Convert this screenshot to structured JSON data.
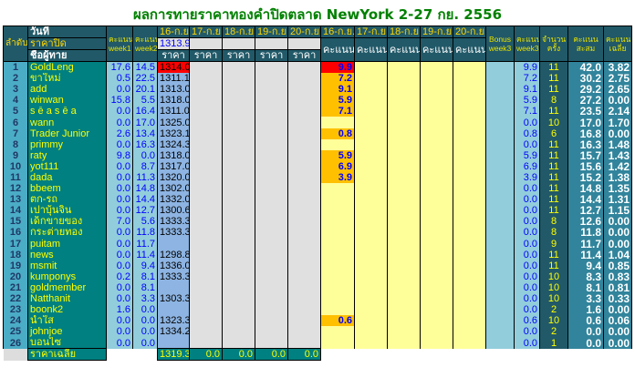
{
  "title": "ผลการทายราคาทองคำปิดตลาด NewYork 2-27 กย. 2556",
  "header": {
    "rank": "ลำดับ",
    "date_label": "วันที่",
    "close_label": "ราคาปิด",
    "name_label": "ชื่อผู้ทาย",
    "week1": "คะแนน week1",
    "week2": "คะแนน week2",
    "dates": [
      "16-ก.ย.",
      "17-ก.ย.",
      "18-ก.ย.",
      "19-ก.ย.",
      "20-ก.ย."
    ],
    "close_prices": [
      "1313.9",
      "",
      "",
      "",
      ""
    ],
    "price_label": "ราคา",
    "score_label": "คะแนน",
    "bonus": "Bonus week3",
    "week3": "คะแนน week3",
    "count": "จำนวนครั้ง",
    "total": "คะแนนสะสม",
    "avg": "คะแนนเฉลี่ย"
  },
  "colors": {
    "header": "#215968",
    "name_col": "#008080",
    "highlight": "#ffc000",
    "best": "#ff0000",
    "title": "#008000"
  },
  "rows": [
    {
      "rank": "1",
      "name": "GoldLeng",
      "w1": "17.6",
      "w2": "14.5",
      "price": "1314.0",
      "score": "9.9",
      "w3": "9.9",
      "count": "11",
      "total": "42.0",
      "avg": "3.82",
      "best": true
    },
    {
      "rank": "2",
      "name": "ขาใหม่",
      "w1": "0.5",
      "w2": "22.5",
      "price": "1311.1",
      "score": "7.2",
      "w3": "7.2",
      "count": "11",
      "total": "30.2",
      "avg": "2.75"
    },
    {
      "rank": "3",
      "name": "add",
      "w1": "0.0",
      "w2": "20.1",
      "price": "1313.0",
      "score": "9.1",
      "w3": "9.1",
      "count": "11",
      "total": "29.2",
      "avg": "2.65"
    },
    {
      "rank": "4",
      "name": "winwan",
      "w1": "15.8",
      "w2": "5.5",
      "price": "1318.0",
      "score": "5.9",
      "w3": "5.9",
      "count": "8",
      "total": "27.2",
      "avg": "0.00"
    },
    {
      "rank": "5",
      "name": "s ē a s ē a",
      "w1": "0.0",
      "w2": "16.4",
      "price": "1311.0",
      "score": "7.1",
      "w3": "7.1",
      "count": "11",
      "total": "23.5",
      "avg": "2.14"
    },
    {
      "rank": "6",
      "name": "wann",
      "w1": "0.0",
      "w2": "17.0",
      "price": "1325.0",
      "score": "",
      "w3": "0.0",
      "count": "10",
      "total": "17.0",
      "avg": "1.70"
    },
    {
      "rank": "7",
      "name": "Trader Junior",
      "w1": "2.6",
      "w2": "13.4",
      "price": "1323.1",
      "score": "0.8",
      "w3": "0.8",
      "count": "6",
      "total": "16.8",
      "avg": "0.00"
    },
    {
      "rank": "8",
      "name": "primmy",
      "w1": "0.0",
      "w2": "16.3",
      "price": "1324.3",
      "score": "",
      "w3": "0.0",
      "count": "11",
      "total": "16.3",
      "avg": "1.48"
    },
    {
      "rank": "9",
      "name": "raty",
      "w1": "9.8",
      "w2": "0.0",
      "price": "1318.0",
      "score": "5.9",
      "w3": "5.9",
      "count": "11",
      "total": "15.7",
      "avg": "1.43"
    },
    {
      "rank": "10",
      "name": "yot111",
      "w1": "0.0",
      "w2": "8.7",
      "price": "1317.0",
      "score": "6.9",
      "w3": "6.9",
      "count": "11",
      "total": "15.6",
      "avg": "1.42"
    },
    {
      "rank": "11",
      "name": "dada",
      "w1": "0.0",
      "w2": "11.3",
      "price": "1320.0",
      "score": "3.9",
      "w3": "3.9",
      "count": "11",
      "total": "15.2",
      "avg": "1.38"
    },
    {
      "rank": "12",
      "name": "bbeem",
      "w1": "0.0",
      "w2": "14.8",
      "price": "1302.0",
      "score": "",
      "w3": "0.0",
      "count": "11",
      "total": "14.8",
      "avg": "1.35"
    },
    {
      "rank": "13",
      "name": "ตก-รถ",
      "w1": "0.0",
      "w2": "14.4",
      "price": "1332.0",
      "score": "",
      "w3": "0.0",
      "count": "11",
      "total": "14.4",
      "avg": "1.31"
    },
    {
      "rank": "14",
      "name": "เปาบุ้นจิ้น",
      "w1": "0.0",
      "w2": "12.7",
      "price": "1300.6",
      "score": "",
      "w3": "0.0",
      "count": "11",
      "total": "12.7",
      "avg": "1.15"
    },
    {
      "rank": "15",
      "name": "เด็กขายของ",
      "w1": "7.0",
      "w2": "5.6",
      "price": "1333.3",
      "score": "",
      "w3": "0.0",
      "count": "8",
      "total": "12.6",
      "avg": "0.00"
    },
    {
      "rank": "16",
      "name": "กระต่ายทอง",
      "w1": "0.0",
      "w2": "11.8",
      "price": "1333.3",
      "score": "",
      "w3": "0.0",
      "count": "8",
      "total": "11.8",
      "avg": "0.00"
    },
    {
      "rank": "17",
      "name": "puitam",
      "w1": "0.0",
      "w2": "11.7",
      "price": "",
      "score": "",
      "w3": "0.0",
      "count": "9",
      "total": "11.7",
      "avg": "0.00"
    },
    {
      "rank": "18",
      "name": "news",
      "w1": "0.0",
      "w2": "11.4",
      "price": "1298.8",
      "score": "",
      "w3": "0.0",
      "count": "11",
      "total": "11.4",
      "avg": "1.04"
    },
    {
      "rank": "19",
      "name": "msmit",
      "w1": "0.0",
      "w2": "9.4",
      "price": "1336.0",
      "score": "",
      "w3": "0.0",
      "count": "11",
      "total": "9.4",
      "avg": "0.85"
    },
    {
      "rank": "20",
      "name": "kumponys",
      "w1": "0.2",
      "w2": "8.1",
      "price": "1333.3",
      "score": "",
      "w3": "0.0",
      "count": "10",
      "total": "8.3",
      "avg": "0.83"
    },
    {
      "rank": "21",
      "name": "goldmember",
      "w1": "0.0",
      "w2": "8.1",
      "price": "",
      "score": "",
      "w3": "0.0",
      "count": "10",
      "total": "8.1",
      "avg": "0.81"
    },
    {
      "rank": "22",
      "name": "Natthanit",
      "w1": "0.0",
      "w2": "3.3",
      "price": "1303.3",
      "score": "",
      "w3": "0.0",
      "count": "10",
      "total": "3.3",
      "avg": "0.33"
    },
    {
      "rank": "23",
      "name": "boonk2",
      "w1": "1.6",
      "w2": "0.0",
      "price": "",
      "score": "",
      "w3": "0.0",
      "count": "2",
      "total": "1.6",
      "avg": "0.00"
    },
    {
      "rank": "24",
      "name": "น้ำใส",
      "w1": "0.0",
      "w2": "0.0",
      "price": "1323.3",
      "score": "0.6",
      "w3": "0.6",
      "count": "10",
      "total": "0.6",
      "avg": "0.06"
    },
    {
      "rank": "25",
      "name": "johnjoe",
      "w1": "0.0",
      "w2": "0.0",
      "price": "1334.2",
      "score": "",
      "w3": "0.0",
      "count": "2",
      "total": "0.0",
      "avg": "0.00"
    },
    {
      "rank": "26",
      "name": "บอนไซ",
      "w1": "0.0",
      "w2": "0.0",
      "price": "",
      "score": "",
      "w3": "0.0",
      "count": "1",
      "total": "0.0",
      "avg": "0.00"
    }
  ],
  "footer": {
    "label": "ราคาเฉลี่ย",
    "avg_prices": [
      "1319.3",
      "0.0",
      "0.0",
      "0.0",
      "0.0"
    ]
  }
}
